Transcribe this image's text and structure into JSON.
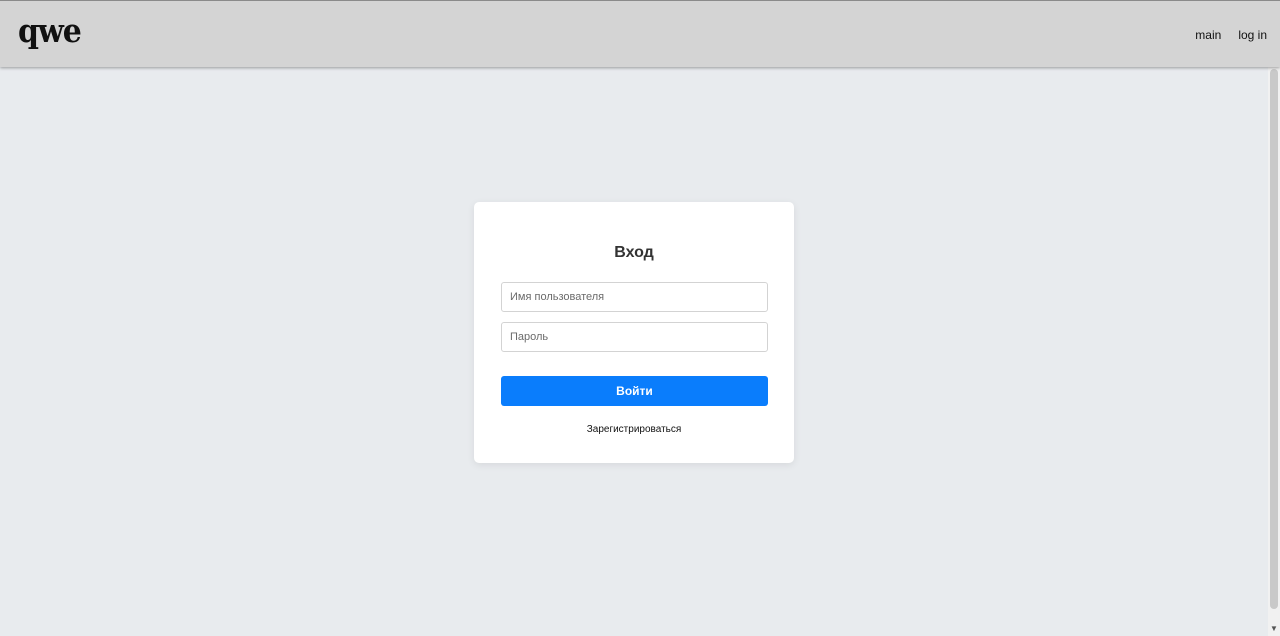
{
  "header": {
    "logo": "qwe",
    "nav": [
      {
        "label": "main"
      },
      {
        "label": "log in"
      }
    ]
  },
  "login_form": {
    "title": "Вход",
    "username": {
      "placeholder": "Имя пользователя",
      "value": ""
    },
    "password": {
      "placeholder": "Пароль",
      "value": ""
    },
    "submit_label": "Войти",
    "register_label": "Зарегистрироваться"
  },
  "colors": {
    "header_bg": "#d4d4d4",
    "page_bg": "#e8ebee",
    "primary_button": "#0a7dfc"
  },
  "icons": {
    "scroll_down": "chevron-down-icon"
  }
}
